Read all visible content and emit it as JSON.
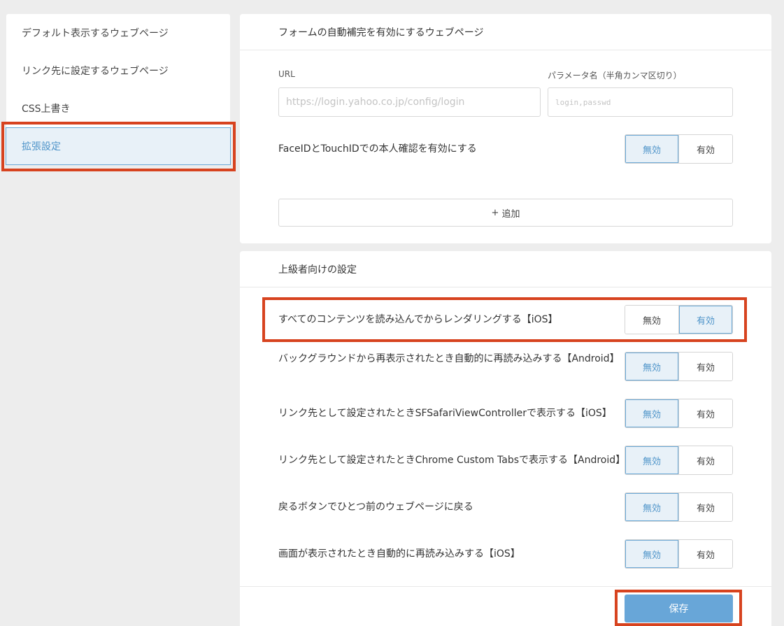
{
  "sidebar": {
    "items": [
      {
        "label": "デフォルト表示するウェブページ"
      },
      {
        "label": "リンク先に設定するウェブページ"
      },
      {
        "label": "CSS上書き"
      },
      {
        "label": "拡張設定"
      }
    ]
  },
  "autofill": {
    "title": "フォームの自動補完を有効にするウェブページ",
    "url_label": "URL",
    "url_placeholder": "https://login.yahoo.co.jp/config/login",
    "param_label": "パラメータ名（半角カンマ区切り）",
    "param_placeholder": "login,passwd",
    "biometric_label": "FaceIDとTouchIDでの本人確認を有効にする",
    "add_label": "追加"
  },
  "toggle_labels": {
    "off": "無効",
    "on": "有効"
  },
  "advanced": {
    "title": "上級者向けの設定",
    "rows": [
      {
        "label": "すべてのコンテンツを読み込んでからレンダリングする【iOS】"
      },
      {
        "label": "バックグラウンドから再表示されたとき自動的に再読み込みする【Android】"
      },
      {
        "label": "リンク先として設定されたときSFSafariViewControllerで表示する【iOS】"
      },
      {
        "label": "リンク先として設定されたときChrome Custom Tabsで表示する【Android】"
      },
      {
        "label": "戻るボタンでひとつ前のウェブページに戻る"
      },
      {
        "label": "画面が表示されたとき自動的に再読み込みする【iOS】"
      }
    ]
  },
  "save_label": "保存",
  "colors": {
    "accent": "#4e94c9",
    "highlight": "#d7431f",
    "save": "#68a6d8"
  }
}
